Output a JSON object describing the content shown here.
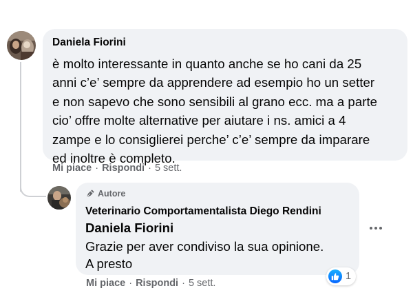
{
  "comment": {
    "author": "Daniela Fiorini",
    "text": "è molto interessante in quanto anche se ho cani da 25\nanni c’e’ sempre da apprendere ad esempio ho un setter\ne non sapevo che sono sensibili al grano ecc. ma a parte\ncio’ offre molte alternative per aiutare i ns. amici a 4\nzampe e lo consiglierei perche’ c’e’ sempre da imparare\ned inoltre è completo.",
    "actions": {
      "like_label": "Mi piace",
      "reply_label": "Rispondi",
      "separator": "·",
      "time": "5 sett."
    }
  },
  "reply": {
    "badge_label": "Autore",
    "page_name": "Veterinario Comportamentalista Diego Rendini",
    "mention": "Daniela Fiorini",
    "text": "Grazie per aver condiviso la sua opinione.\nA presto",
    "actions": {
      "like_label": "Mi piace",
      "reply_label": "Rispondi",
      "separator": "·",
      "time": "5 sett."
    },
    "reactions": {
      "type": "like",
      "count": "1"
    }
  },
  "colors": {
    "bubble_bg": "#f0f2f5",
    "meta_text": "#65676b",
    "like_blue": "#0866ff",
    "thread_line": "#ced0d4"
  },
  "icons": {
    "author_badge": "pen-nib-icon",
    "reaction": "thumbs-up-icon",
    "more": "more-options-icon"
  }
}
